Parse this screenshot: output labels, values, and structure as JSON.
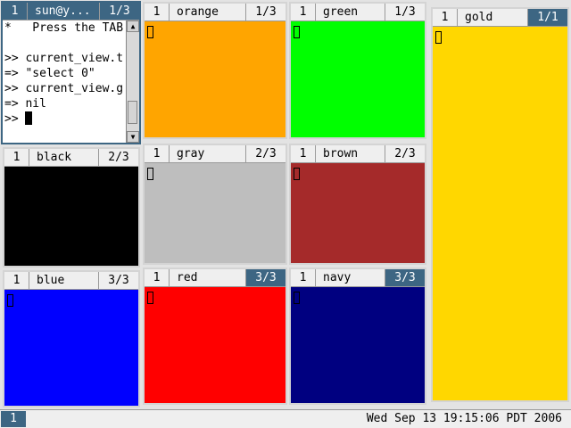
{
  "terminal": {
    "tag": "1",
    "name": "sun@y...",
    "index": "1/3",
    "lines": [
      "*   Press the TAB",
      "",
      ">> current_view.t",
      "=> \"select 0\"",
      ">> current_view.g",
      "=> nil",
      ">> "
    ]
  },
  "clients": [
    {
      "tag": "1",
      "name": "orange",
      "index": "1/3",
      "color": "#ffa500"
    },
    {
      "tag": "1",
      "name": "green",
      "index": "1/3",
      "color": "#00ff00"
    },
    {
      "tag": "1",
      "name": "gold",
      "index": "1/1",
      "color": "#ffd700"
    },
    {
      "tag": "1",
      "name": "black",
      "index": "2/3",
      "color": "#000000"
    },
    {
      "tag": "1",
      "name": "gray",
      "index": "2/3",
      "color": "#bebebe"
    },
    {
      "tag": "1",
      "name": "brown",
      "index": "2/3",
      "color": "#a52a2a"
    },
    {
      "tag": "1",
      "name": "blue",
      "index": "3/3",
      "color": "#0000ff"
    },
    {
      "tag": "1",
      "name": "red",
      "index": "3/3",
      "color": "#ff0000"
    },
    {
      "tag": "1",
      "name": "navy",
      "index": "3/3",
      "color": "#000080"
    }
  ],
  "statusbar": {
    "tag": "1",
    "clock": "Wed Sep 13 19:15:06 PDT 2006"
  },
  "colors": {
    "focus": "#3d6683",
    "title_bg": "#efefef",
    "separator": "#d4d4d4"
  }
}
